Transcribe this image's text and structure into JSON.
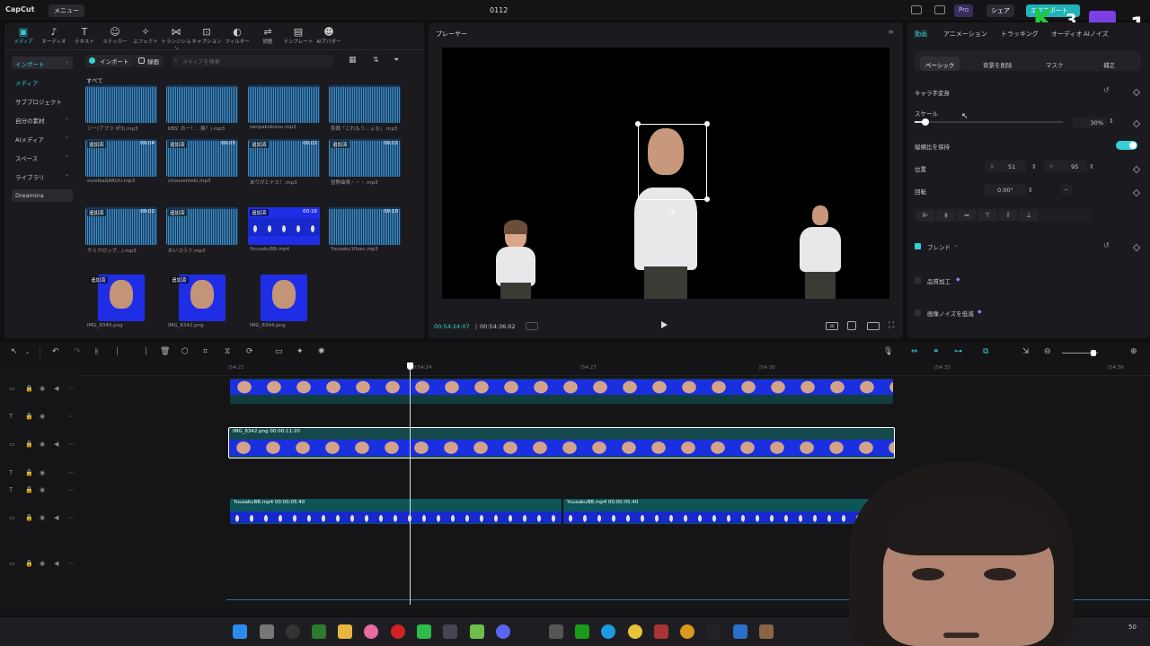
{
  "titlebar": {
    "logo": "CapCut",
    "menu": "メニュー",
    "project": "0112",
    "pro": "Pro",
    "share": "シェア",
    "export": "エクスポート",
    "overlay_k": "3",
    "overlay_num": "1"
  },
  "toolbar": {
    "items": [
      {
        "label": "メディア",
        "icon": "media-icon"
      },
      {
        "label": "オーディオ",
        "icon": "audio-icon"
      },
      {
        "label": "テキスト",
        "icon": "text-icon"
      },
      {
        "label": "ステッカー",
        "icon": "sticker-icon"
      },
      {
        "label": "エフェクト",
        "icon": "effect-icon"
      },
      {
        "label": "トランジション",
        "icon": "transition-icon"
      },
      {
        "label": "キャプション",
        "icon": "caption-icon"
      },
      {
        "label": "フィルター",
        "icon": "filter-icon"
      },
      {
        "label": "調整",
        "icon": "adjust-icon"
      },
      {
        "label": "テンプレート",
        "icon": "template-icon"
      },
      {
        "label": "AIアバター",
        "icon": "ai-avatar-icon"
      }
    ]
  },
  "sidebar": {
    "items": [
      "インポート",
      "メディア",
      "サブプロジェクト",
      "自分の素材",
      "AIメディア",
      "スペース",
      "ライブラリ",
      "Dreamina"
    ]
  },
  "media": {
    "import_btn": "インポート",
    "record_btn": "録画",
    "search_placeholder": "メディアを検索",
    "all_label": "すべて",
    "tiles": [
      {
        "name": "ジー(アプラ ぜ3).mp3",
        "badge": "",
        "dur": ""
      },
      {
        "name": "KBS' おー！…無？).mp3",
        "badge": "",
        "dur": ""
      },
      {
        "name": "senpakukisou.mp3",
        "badge": "",
        "dur": ""
      },
      {
        "name": "剪裁「これもう…ょな」.mp3",
        "badge": "",
        "dur": ""
      },
      {
        "name": "soreikaSARUU.mp3",
        "badge": "追加済",
        "dur": "00:04"
      },
      {
        "name": "chousenteki.mp3",
        "badge": "追加済",
        "dur": "00:05"
      },
      {
        "name": "ありがとナス！.mp3",
        "badge": "追加済",
        "dur": "00:02"
      },
      {
        "name": "冒野曲嗚・・・.mp3",
        "badge": "追加済",
        "dur": "00:02"
      },
      {
        "name": "サミクロップ…).mp3",
        "badge": "追加済",
        "dur": "00:02"
      },
      {
        "name": "おいコラァ.mp3",
        "badge": "追加済",
        "dur": ""
      },
      {
        "name": "YuusakuBB.mp4",
        "badge": "追加済",
        "dur": "00:16"
      },
      {
        "name": "Yuusaku10sec.mp3",
        "badge": "",
        "dur": "00:18"
      },
      {
        "name": "IMG_8340.png",
        "badge": "追加済",
        "dur": ""
      },
      {
        "name": "IMG_8342.png",
        "badge": "追加済",
        "dur": ""
      },
      {
        "name": "IMG_8344.png",
        "badge": "",
        "dur": ""
      }
    ]
  },
  "player": {
    "title": "プレーヤー",
    "current": "00:54:24:07",
    "total": "00:54:36:02"
  },
  "props": {
    "tabs": [
      "動画",
      "アニメーション",
      "トラッキング",
      "オーディオ",
      "AIノイズ"
    ],
    "subtabs": [
      "ベーシック",
      "背景を削除",
      "マスク",
      "補正"
    ],
    "transform": "キャラ字変身",
    "scale_label": "スケール",
    "scale_value": "30%",
    "keep_ratio": "縦横比を保持",
    "position_label": "位置",
    "pos_x_label": "X",
    "pos_x": "51",
    "pos_y_label": "Y",
    "pos_y": "95",
    "rotation_label": "回転",
    "rotation": "0.00°",
    "blend": "ブレンド",
    "quality": "品質加工",
    "noise": "画像ノイズを低減",
    "accent": "#35d0d6"
  },
  "timeline": {
    "ticks": [
      "|54:21",
      "|00:54:24",
      "|54:27",
      "|54:30",
      "|54:33",
      "|54:36"
    ],
    "clip_overlay_label": "IMG_8342.png  00:00:11:20",
    "clip_video1_label": "YuusakuBB.mp4  00:00:05:40",
    "clip_video2_label": "YuusakuBB.mp4  00:00:05:40"
  },
  "taskbar": {
    "clock": "50"
  }
}
